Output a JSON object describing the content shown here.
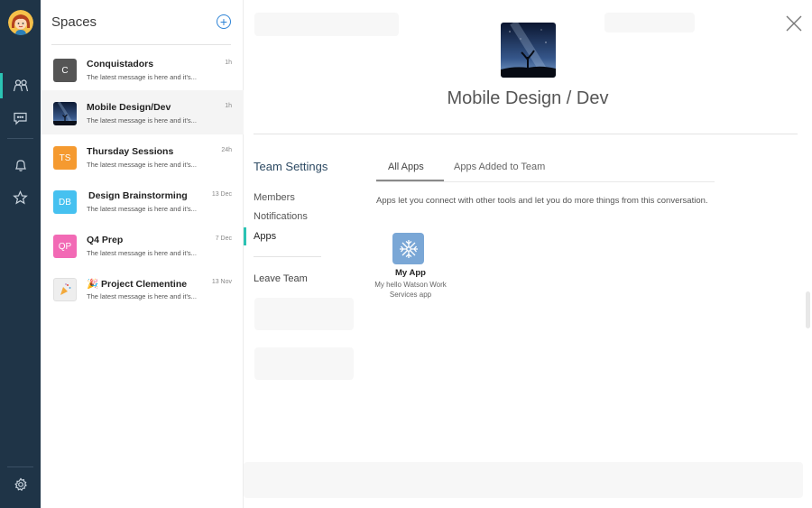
{
  "rail": {
    "avatar_icon": "user-avatar-icon",
    "items": [
      {
        "icon": "people-icon",
        "active": true
      },
      {
        "icon": "chat-icon",
        "active": false
      },
      {
        "icon": "bell-icon",
        "active": false
      },
      {
        "icon": "star-icon",
        "active": false
      }
    ],
    "settings_icon": "gear-icon"
  },
  "spaces": {
    "title": "Spaces",
    "add_icon": "add-circle-icon",
    "items": [
      {
        "initials": "C",
        "name": "Conquistadors",
        "preview": "The latest message is here and it's...",
        "time": "1h",
        "color": "#555555"
      },
      {
        "initials": "",
        "name": "Mobile Design/Dev",
        "preview": "The latest message is here and it's...",
        "time": "1h",
        "color": "#1c2c46"
      },
      {
        "initials": "TS",
        "name": "Thursday Sessions",
        "preview": "The latest message is here and it's...",
        "time": "24h",
        "color": "#f59a30"
      },
      {
        "initials": "DB",
        "name": "Design Brainstorming",
        "preview": "The latest message is here and it's...",
        "time": "13 Dec",
        "color": "#46c1f0"
      },
      {
        "initials": "QP",
        "name": "Q4 Prep",
        "preview": "The latest message is here and it's...",
        "time": "7 Dec",
        "color": "#f26ab5"
      },
      {
        "initials": "",
        "name": "🎉 Project Clementine",
        "preview": "The latest message is here and it's...",
        "time": "13 Nov",
        "color": "#eeeeee"
      }
    ]
  },
  "team": {
    "title": "Mobile Design / Dev",
    "close_icon": "close-icon"
  },
  "settings": {
    "heading": "Team Settings",
    "nav": [
      {
        "label": "Members",
        "active": false
      },
      {
        "label": "Notifications",
        "active": false
      },
      {
        "label": "Apps",
        "active": true
      }
    ],
    "leave": "Leave Team"
  },
  "apps_panel": {
    "tabs": [
      {
        "label": "All Apps",
        "active": true
      },
      {
        "label": "Apps Added to Team",
        "active": false
      }
    ],
    "description": "Apps let you connect with other tools and let you do more things from this conversation.",
    "apps": [
      {
        "name": "My App",
        "description": "My hello Watson Work Services app",
        "icon": "app-snowflake-icon"
      }
    ]
  },
  "colors": {
    "rail_bg": "#1f3447",
    "accent": "#2bc3b4",
    "link": "#2f84d6"
  }
}
